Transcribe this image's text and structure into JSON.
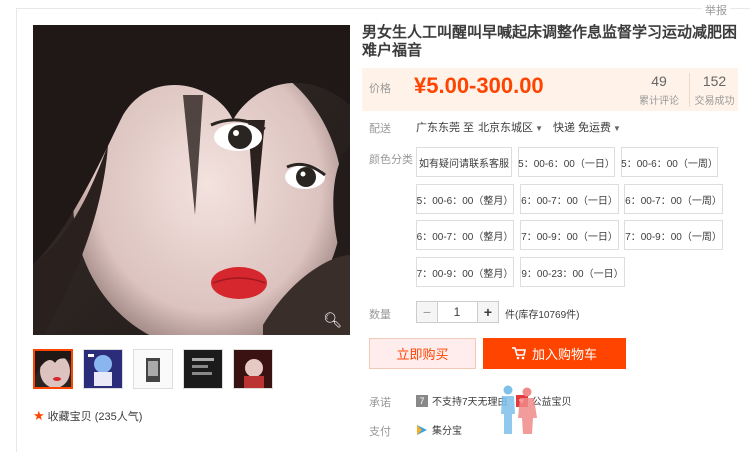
{
  "report_label": "举报",
  "title": "男女生人工叫醒叫早喊起床调整作息监督学习运动减肥困难户福音",
  "price": {
    "label": "价格",
    "value": "¥5.00-300.00"
  },
  "stats": {
    "reviews": {
      "count": "49",
      "label": "累计评论"
    },
    "trades": {
      "count": "152",
      "label": "交易成功"
    }
  },
  "delivery": {
    "label": "配送",
    "from": "广东东莞 至",
    "to": "北京东城区",
    "method": "快递 免运费"
  },
  "sku": {
    "label": "颜色分类",
    "options": [
      "如有疑问请联系客服",
      "5：00-6：00（一日）",
      "5：00-6：00（一周）",
      "5：00-6：00（整月）",
      "6：00-7：00（一日）",
      "6：00-7：00（一周）",
      "6：00-7：00（整月）",
      "7：00-9：00（一日）",
      "7：00-9：00（一周）",
      "7：00-9：00（整月）",
      "9：00-23：00（一日）"
    ]
  },
  "quantity": {
    "label": "数量",
    "value": "1",
    "minus": "−",
    "plus": "+",
    "stock": "件(库存10769件)"
  },
  "buttons": {
    "buy_now": "立即购买",
    "add_to_cart": "加入购物车"
  },
  "promise": {
    "label": "承诺",
    "badge": "7",
    "text": "不支持7天无理由",
    "charity": "公益宝贝"
  },
  "payment": {
    "label": "支付",
    "method": "集分宝"
  },
  "favorite": {
    "text": "收藏宝贝 (235人气)"
  },
  "colors": {
    "accent": "#ff4400",
    "price_bg": "#fff2e8"
  }
}
